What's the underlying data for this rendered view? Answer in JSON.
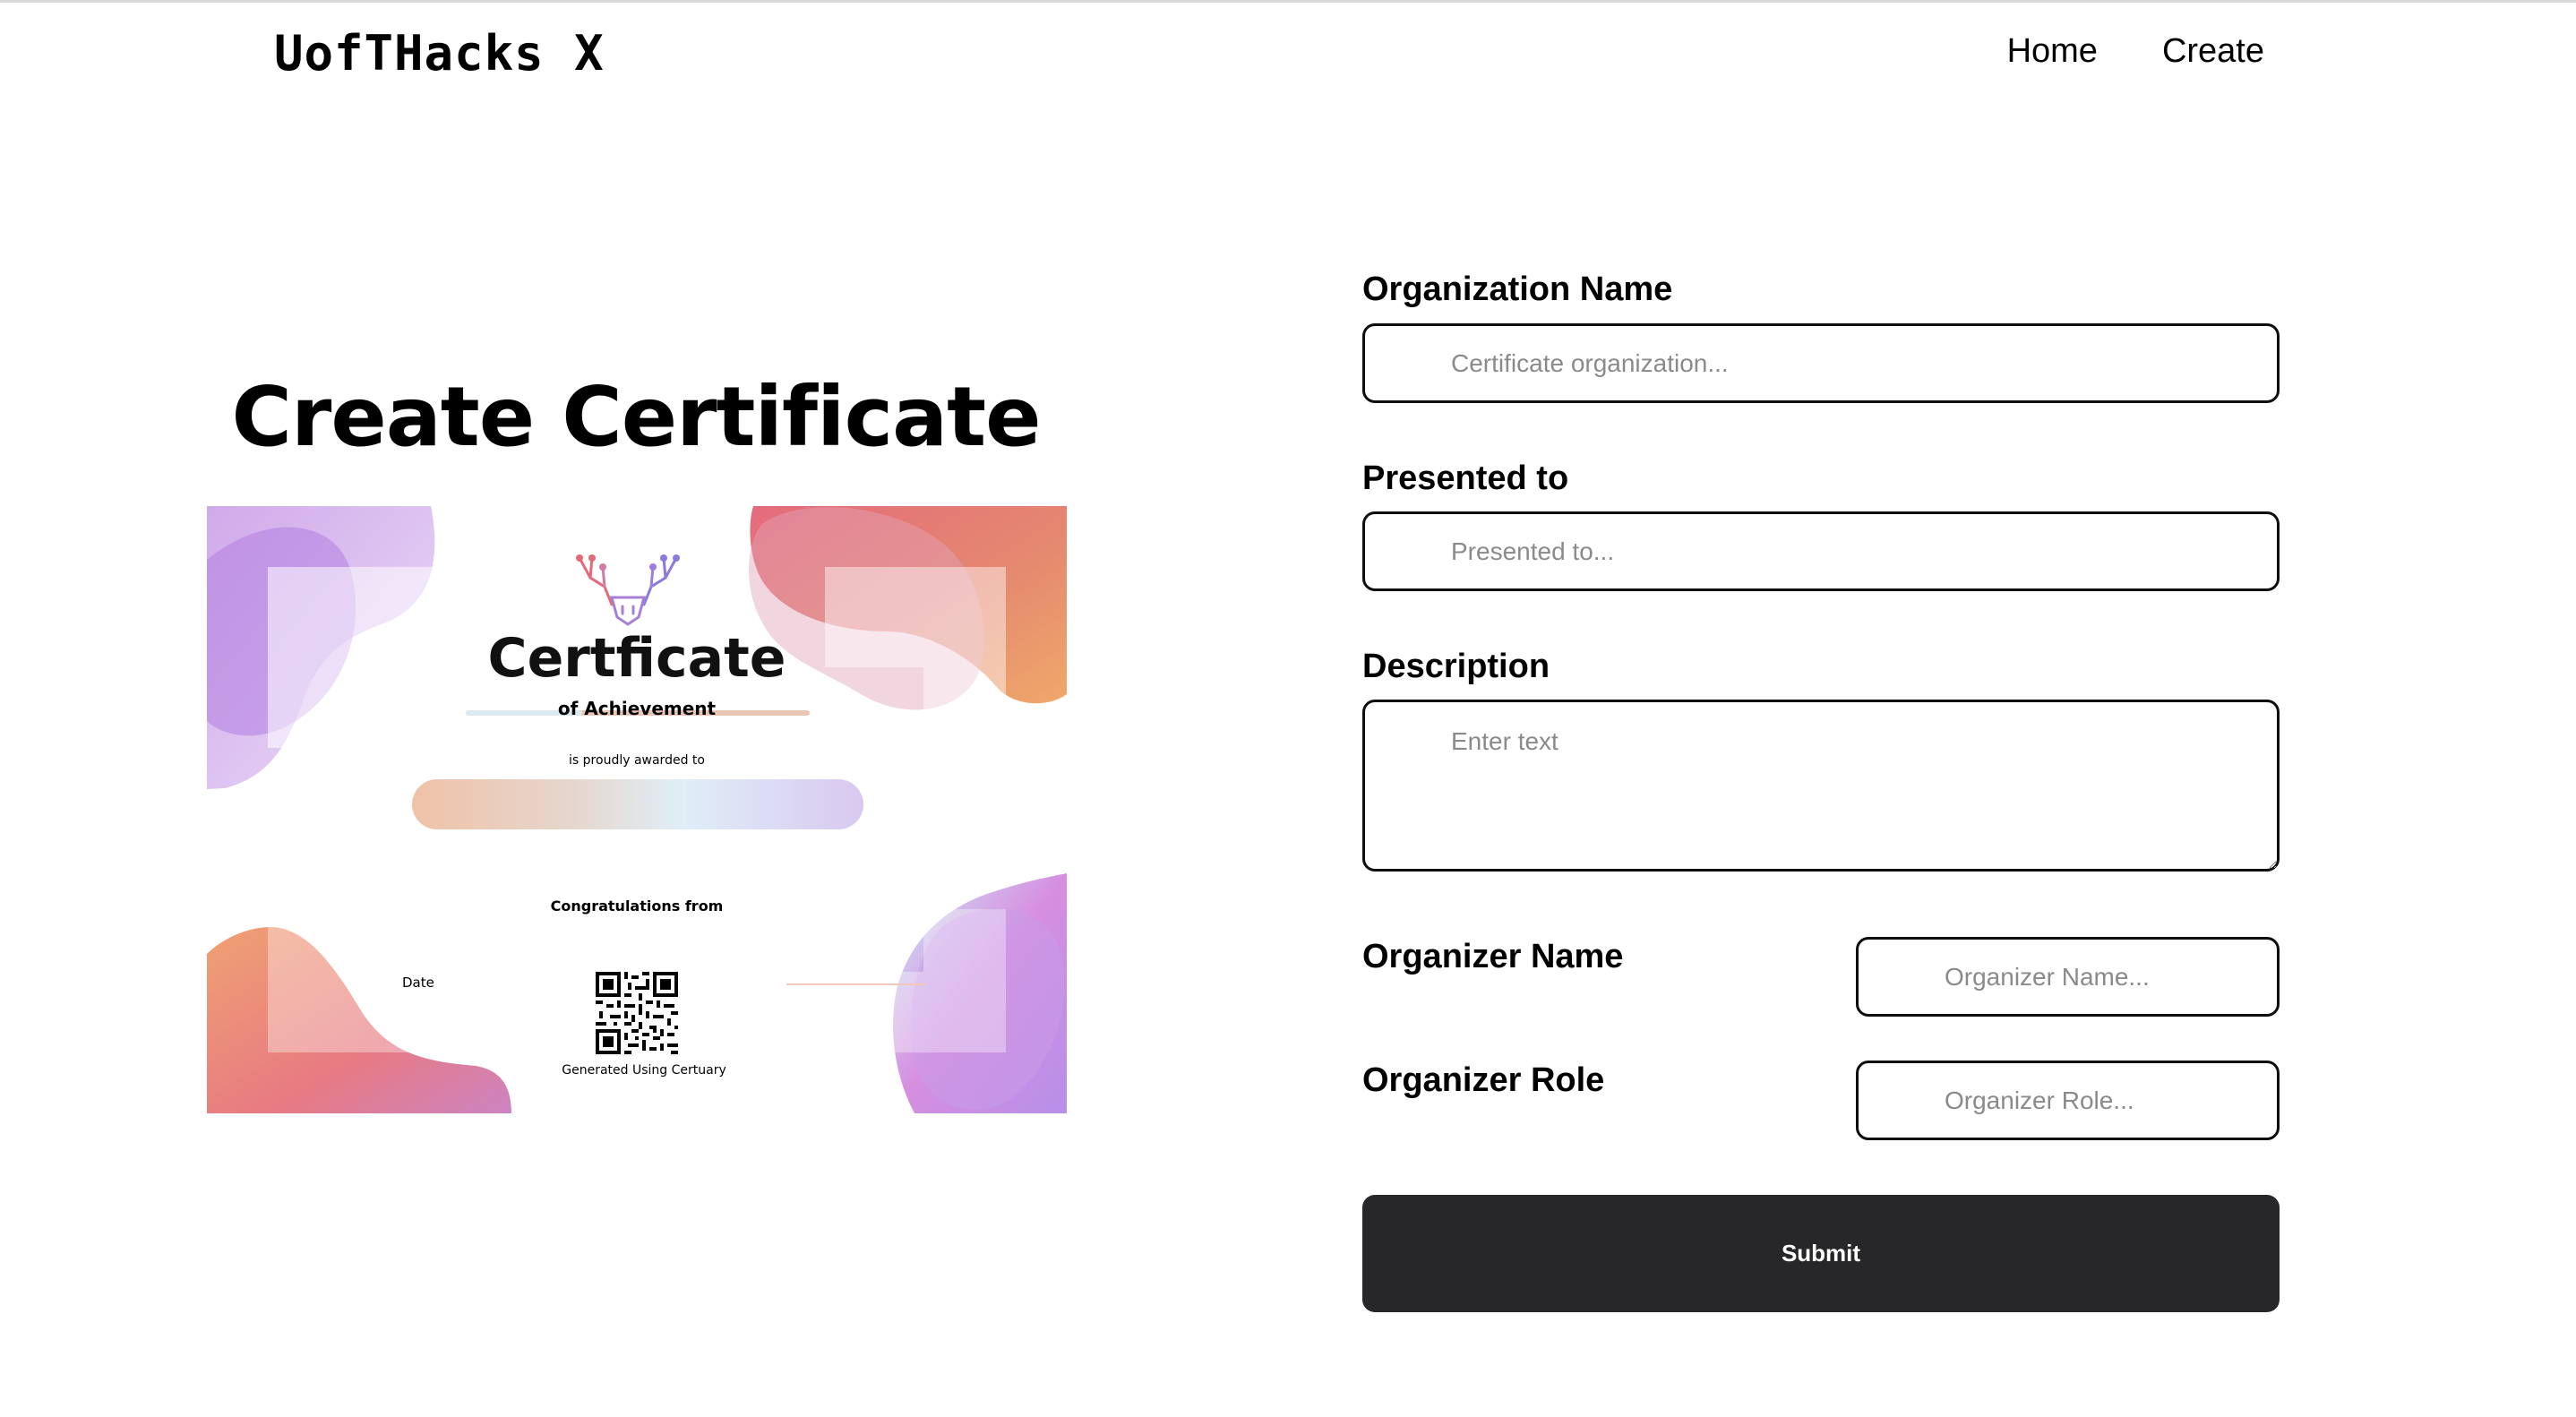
{
  "header": {
    "logo": "UofTHacks X",
    "nav": [
      {
        "label": "Home"
      },
      {
        "label": "Create"
      }
    ]
  },
  "page": {
    "title": "Create Certificate"
  },
  "certificate": {
    "heading": "Certficate",
    "subheading": "of Achievement",
    "awarded_text": "is proudly awarded to",
    "congrats_text": "Congratulations from",
    "date_label": "Date",
    "generated_text": "Generated Using Certuary",
    "colors": {
      "orange": "#e9966a",
      "pink": "#e26a8c",
      "purple": "#b98be8",
      "lavender": "#d5c0f2",
      "light_blue": "#cdeaf7"
    }
  },
  "form": {
    "org_name": {
      "label": "Organization Name",
      "placeholder": "Certificate organization..."
    },
    "presented_to": {
      "label": "Presented to",
      "placeholder": "Presented to..."
    },
    "description": {
      "label": "Description",
      "placeholder": "Enter text"
    },
    "organizer_name": {
      "label": "Organizer Name",
      "placeholder": "Organizer Name..."
    },
    "organizer_role": {
      "label": "Organizer Role",
      "placeholder": "Organizer Role..."
    },
    "submit_label": "Submit"
  }
}
